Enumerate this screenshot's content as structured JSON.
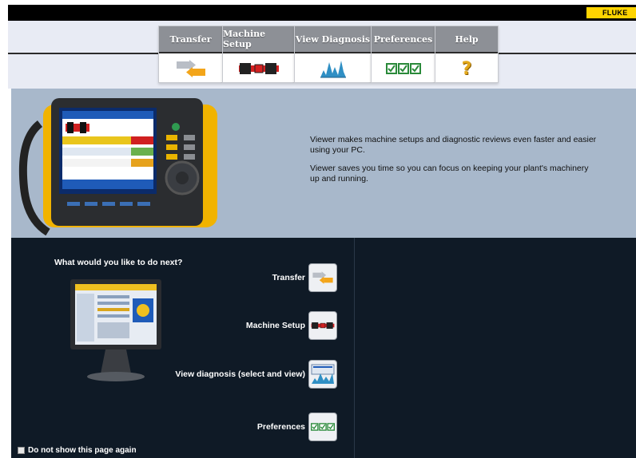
{
  "header": {
    "brand": "FLUKE"
  },
  "tabs": [
    {
      "label": "Transfer",
      "icon": "transfer-icon"
    },
    {
      "label": "Machine Setup",
      "icon": "machine-setup-icon"
    },
    {
      "label": "View Diagnosis",
      "icon": "view-diagnosis-icon"
    },
    {
      "label": "Preferences",
      "icon": "preferences-icon"
    },
    {
      "label": "Help",
      "icon": "help-icon"
    }
  ],
  "hero": {
    "line1": "Viewer makes machine setups and diagnostic reviews even faster and easier using  your PC.",
    "line2": "Viewer saves  you time so you can focus on keeping  your plant's machinery up and running."
  },
  "next": {
    "prompt": "What would you like to do next?",
    "actions": [
      {
        "label": "Transfer",
        "icon": "transfer-icon"
      },
      {
        "label": "Machine Setup",
        "icon": "machine-setup-icon"
      },
      {
        "label": "View diagnosis (select and view)",
        "icon": "view-diagnosis-icon"
      },
      {
        "label": "Preferences",
        "icon": "preferences-icon"
      }
    ]
  },
  "footer": {
    "checkbox_label": "Do not show this page again",
    "checked": false
  },
  "colors": {
    "accent": "#ffd400",
    "dark_panel": "#0f1a26",
    "hero_bg": "#a8b8cb"
  }
}
